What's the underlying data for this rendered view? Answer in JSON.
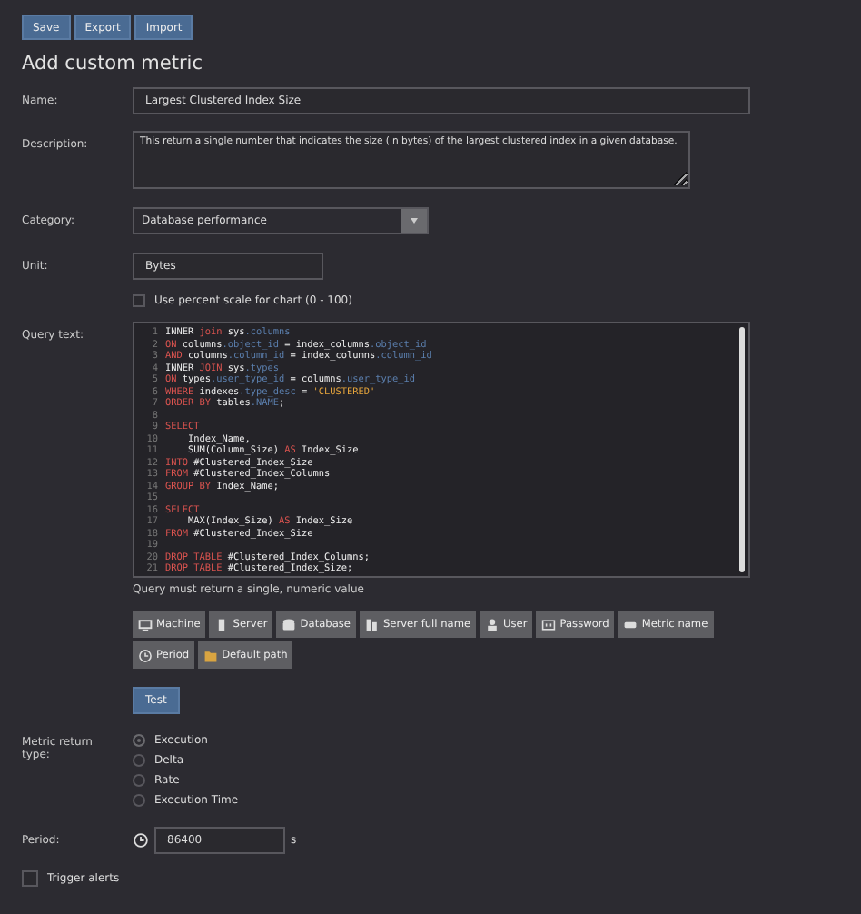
{
  "toolbar": [
    {
      "label": "Save"
    },
    {
      "label": "Export"
    },
    {
      "label": "Import"
    }
  ],
  "title": "Add custom metric",
  "name": {
    "label": "Name:",
    "value": "Largest Clustered Index Size"
  },
  "description": {
    "label": "Description:",
    "value": "This return a single number that indicates the size (in bytes) of the largest clustered index in a given database."
  },
  "category": {
    "label": "Category:",
    "value": "Database performance"
  },
  "unit": {
    "label": "Unit:",
    "value": "Bytes"
  },
  "percent_scale": {
    "label": "Use percent scale for chart (0 - 100)",
    "checked": false
  },
  "query": {
    "label": "Query text:",
    "lines": [
      {
        "n": "1",
        "parts": [
          {
            "kind": "id",
            "t": "INNER "
          },
          {
            "kind": "kw",
            "t": "join"
          },
          {
            "kind": "id",
            "t": " sys"
          },
          {
            "kind": "mem",
            "t": ".columns"
          }
        ]
      },
      {
        "n": "2",
        "parts": [
          {
            "kind": "kw",
            "t": "ON"
          },
          {
            "kind": "id",
            "t": " columns"
          },
          {
            "kind": "mem",
            "t": ".object_id"
          },
          {
            "kind": "id",
            "t": " = index_columns"
          },
          {
            "kind": "mem",
            "t": ".object_id"
          }
        ]
      },
      {
        "n": "3",
        "parts": [
          {
            "kind": "kw",
            "t": "AND"
          },
          {
            "kind": "id",
            "t": " columns"
          },
          {
            "kind": "mem",
            "t": ".column_id"
          },
          {
            "kind": "id",
            "t": " = index_columns"
          },
          {
            "kind": "mem",
            "t": ".column_id"
          }
        ]
      },
      {
        "n": "4",
        "parts": [
          {
            "kind": "id",
            "t": "INNER "
          },
          {
            "kind": "kw",
            "t": "JOIN"
          },
          {
            "kind": "id",
            "t": " sys"
          },
          {
            "kind": "mem",
            "t": ".types"
          }
        ]
      },
      {
        "n": "5",
        "parts": [
          {
            "kind": "kw",
            "t": "ON"
          },
          {
            "kind": "id",
            "t": " types"
          },
          {
            "kind": "mem",
            "t": ".user_type_id"
          },
          {
            "kind": "id",
            "t": " = columns"
          },
          {
            "kind": "mem",
            "t": ".user_type_id"
          }
        ]
      },
      {
        "n": "6",
        "parts": [
          {
            "kind": "kw",
            "t": "WHERE"
          },
          {
            "kind": "id",
            "t": " indexes"
          },
          {
            "kind": "mem",
            "t": ".type_desc"
          },
          {
            "kind": "id",
            "t": " = "
          },
          {
            "kind": "str",
            "t": "'CLUSTERED'"
          }
        ]
      },
      {
        "n": "7",
        "parts": [
          {
            "kind": "kw",
            "t": "ORDER BY"
          },
          {
            "kind": "id",
            "t": " tables"
          },
          {
            "kind": "mem",
            "t": ".NAME"
          },
          {
            "kind": "id",
            "t": ";"
          }
        ]
      },
      {
        "n": "8"
      },
      {
        "n": "9",
        "parts": [
          {
            "kind": "kw",
            "t": "SELECT"
          }
        ]
      },
      {
        "n": "10",
        "parts": [
          {
            "kind": "id",
            "t": "    Index_Name,"
          }
        ]
      },
      {
        "n": "11",
        "parts": [
          {
            "kind": "id",
            "t": "    SUM(Column_Size) "
          },
          {
            "kind": "kw",
            "t": "AS"
          },
          {
            "kind": "id",
            "t": " Index_Size"
          }
        ]
      },
      {
        "n": "12",
        "parts": [
          {
            "kind": "kw",
            "t": "INTO"
          },
          {
            "kind": "id",
            "t": " #Clustered_Index_Size"
          }
        ]
      },
      {
        "n": "13",
        "parts": [
          {
            "kind": "kw",
            "t": "FROM"
          },
          {
            "kind": "id",
            "t": " #Clustered_Index_Columns"
          }
        ]
      },
      {
        "n": "14",
        "parts": [
          {
            "kind": "kw",
            "t": "GROUP BY"
          },
          {
            "kind": "id",
            "t": " Index_Name;"
          }
        ]
      },
      {
        "n": "15"
      },
      {
        "n": "16",
        "parts": [
          {
            "kind": "kw",
            "t": "SELECT"
          }
        ]
      },
      {
        "n": "17",
        "parts": [
          {
            "kind": "id",
            "t": "    MAX(Index_Size) "
          },
          {
            "kind": "kw",
            "t": "AS"
          },
          {
            "kind": "id",
            "t": " Index_Size"
          }
        ]
      },
      {
        "n": "18",
        "parts": [
          {
            "kind": "kw",
            "t": "FROM"
          },
          {
            "kind": "id",
            "t": " #Clustered_Index_Size"
          }
        ]
      },
      {
        "n": "19"
      },
      {
        "n": "20",
        "parts": [
          {
            "kind": "kw",
            "t": "DROP TABLE"
          },
          {
            "kind": "id",
            "t": " #Clustered_Index_Columns;"
          }
        ]
      },
      {
        "n": "21",
        "parts": [
          {
            "kind": "kw",
            "t": "DROP TABLE"
          },
          {
            "kind": "id",
            "t": " #Clustered_Index_Size;"
          }
        ]
      }
    ],
    "hint": "Query must return a single, numeric value"
  },
  "placeholders": [
    {
      "kind": "machine",
      "label": "Machine"
    },
    {
      "kind": "server",
      "label": "Server"
    },
    {
      "kind": "database",
      "label": "Database"
    },
    {
      "kind": "servers",
      "label": "Server full name"
    },
    {
      "kind": "user",
      "label": "User"
    },
    {
      "kind": "password",
      "label": "Password"
    },
    {
      "kind": "tag",
      "label": "Metric name"
    },
    {
      "kind": "clock",
      "label": "Period"
    },
    {
      "kind": "folder",
      "label": "Default path"
    }
  ],
  "test_button": "Test",
  "return_type": {
    "label": "Metric return type:",
    "options": [
      {
        "label": "Execution",
        "selected": true
      },
      {
        "label": "Delta",
        "selected": false
      },
      {
        "label": "Rate",
        "selected": false
      },
      {
        "label": "Execution Time",
        "selected": false
      }
    ]
  },
  "period": {
    "label": "Period:",
    "value": "86400",
    "unit": "s"
  },
  "trigger_alerts": {
    "label": "Trigger alerts",
    "checked": false
  }
}
